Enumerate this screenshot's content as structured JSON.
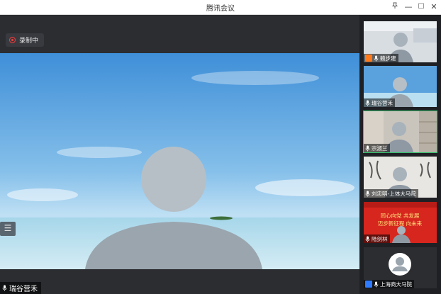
{
  "window": {
    "title": "腾讯会议",
    "controls": {
      "minimize": "—",
      "maximize": "☐",
      "close": "✕"
    }
  },
  "recording": {
    "label": "录制中"
  },
  "main_speaker": {
    "name": "瑞谷营禾"
  },
  "participants": [
    {
      "name": "赖步建",
      "has_badge": true,
      "badge_color": "#ff7a1a",
      "active": false
    },
    {
      "name": "瑞谷营禾",
      "has_badge": false,
      "active": false
    },
    {
      "name": "宗淑兰",
      "has_badge": false,
      "active": true
    },
    {
      "name": "刘忠明-上体大马院",
      "has_badge": false,
      "active": false
    },
    {
      "name": "陆剑林",
      "has_badge": false,
      "active": false
    },
    {
      "name": "上海商大马院",
      "has_badge": true,
      "badge_color": "#2f7bff",
      "active": false
    }
  ],
  "banner_text": {
    "line1": "同心向党 共发展",
    "line2": "迈步新征程 向未来"
  },
  "colors": {
    "accent_green": "#35c16c",
    "record_red": "#ff3b3b",
    "badge_orange": "#ff7a1a",
    "badge_blue": "#2f7bff"
  }
}
